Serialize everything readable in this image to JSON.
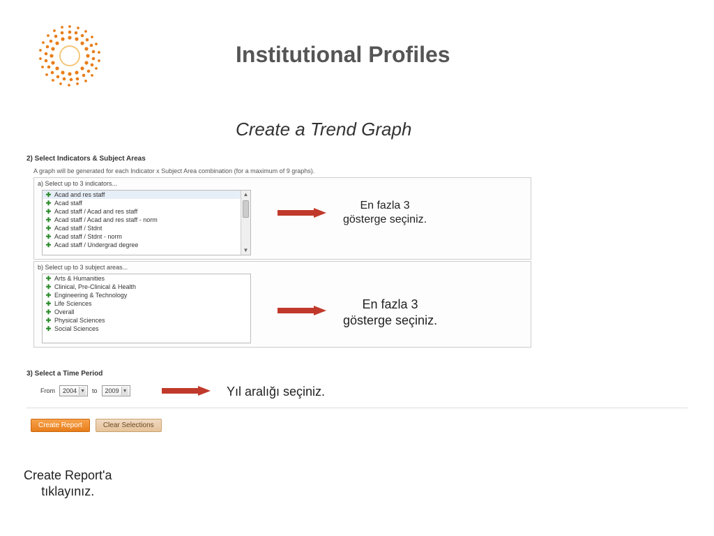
{
  "header": {
    "title": "Institutional Profiles",
    "subtitle": "Create a Trend Graph"
  },
  "step2": {
    "title": "2) Select Indicators & Subject Areas",
    "desc": "A graph will be generated for each Indicator x Subject Area combination (for a maximum of 9 graphs).",
    "sub_a": "a) Select up to 3 indicators...",
    "sub_b": "b) Select up to 3 subject areas...",
    "indicators": [
      "Acad and res staff",
      "Acad staff",
      "Acad staff / Acad and res staff",
      "Acad staff / Acad and res staff - norm",
      "Acad staff / Stdnt",
      "Acad staff / Stdnt - norm",
      "Acad staff / Undergrad degree"
    ],
    "subjects": [
      "Arts & Humanities",
      "Clinical, Pre-Clinical & Health",
      "Engineering & Technology",
      "Life Sciences",
      "Overall",
      "Physical Sciences",
      "Social Sciences"
    ]
  },
  "step3": {
    "title": "3) Select a Time Period",
    "from_label": "From",
    "from_value": "2004",
    "to_label": "to",
    "to_value": "2009"
  },
  "buttons": {
    "create": "Create Report",
    "clear": "Clear Selections"
  },
  "callouts": {
    "c1_line1": "En fazla 3",
    "c1_line2": "gösterge seçiniz.",
    "c2_line1": "En fazla 3",
    "c2_line2": "gösterge seçiniz.",
    "c3": "Yıl aralığı seçiniz.",
    "c4_line1": "Create Report'a",
    "c4_line2": "tıklayınız."
  }
}
